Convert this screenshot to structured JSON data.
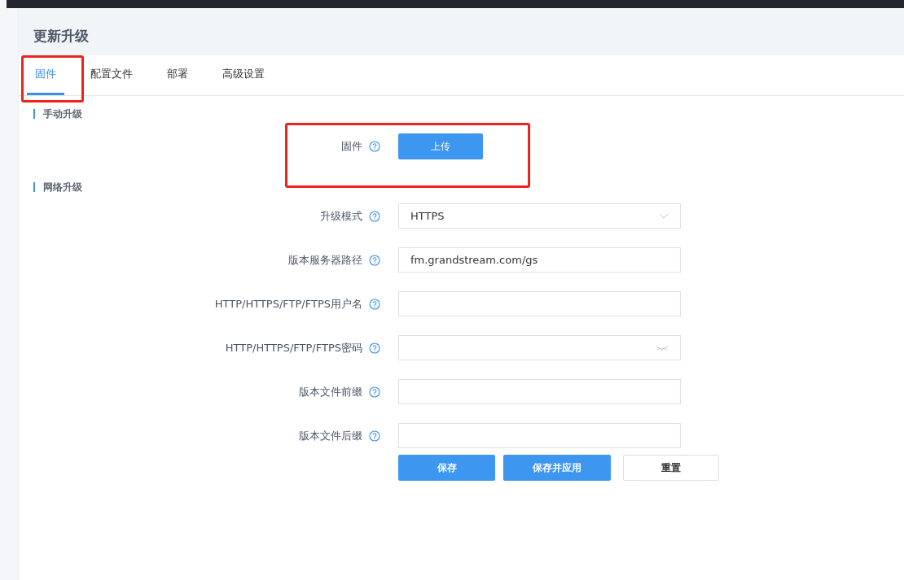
{
  "page": {
    "title": "更新升级"
  },
  "tabs": [
    {
      "label": "固件",
      "selected": true
    },
    {
      "label": "配置文件",
      "selected": false
    },
    {
      "label": "部署",
      "selected": false
    },
    {
      "label": "高级设置",
      "selected": false
    }
  ],
  "manual_upgrade": {
    "heading": "手动升级",
    "label": "固件",
    "button": "上传"
  },
  "network_upgrade": {
    "heading": "网络升级",
    "fields": [
      {
        "kind": "select",
        "label": "升级模式",
        "value": "HTTPS"
      },
      {
        "kind": "text",
        "label": "版本服务器路径",
        "value": "fm.grandstream.com/gs"
      },
      {
        "kind": "text",
        "label": "HTTP/HTTPS/FTP/FTPS用户名"
      },
      {
        "kind": "password",
        "label": "HTTP/HTTPS/FTP/FTPS密码"
      },
      {
        "kind": "text",
        "label": "版本文件前缀"
      },
      {
        "kind": "text",
        "label": "版本文件后缀"
      }
    ],
    "buttons": [
      {
        "label": "保存",
        "kind": "primary"
      },
      {
        "label": "保存并应用",
        "kind": "primary"
      },
      {
        "label": "重置",
        "kind": "plain"
      }
    ]
  }
}
